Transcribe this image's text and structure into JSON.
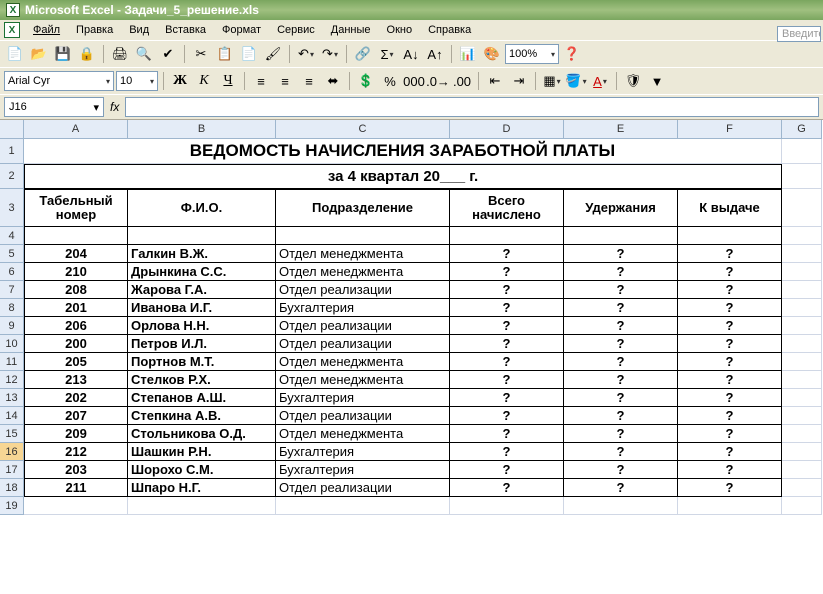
{
  "app": {
    "title": "Microsoft Excel - Задачи_5_решение.xls"
  },
  "search": {
    "placeholder": "Введите"
  },
  "menu": {
    "file": "Файл",
    "edit": "Правка",
    "view": "Вид",
    "insert": "Вставка",
    "format": "Формат",
    "service": "Сервис",
    "data": "Данные",
    "window": "Окно",
    "help": "Справка"
  },
  "toolbar": {
    "zoom": "100%"
  },
  "font": {
    "name": "Arial Cyr",
    "size": "10"
  },
  "namebox": {
    "value": "J16"
  },
  "columns": [
    "A",
    "B",
    "C",
    "D",
    "E",
    "F",
    "G"
  ],
  "rows": [
    "1",
    "2",
    "3",
    "4",
    "5",
    "6",
    "7",
    "8",
    "9",
    "10",
    "11",
    "12",
    "13",
    "14",
    "15",
    "16",
    "17",
    "18",
    "19"
  ],
  "sheet": {
    "title": "ВЕДОМОСТЬ НАЧИСЛЕНИЯ ЗАРАБОТНОЙ ПЛАТЫ",
    "subtitle": "за 4 квартал 20___ г.",
    "headers": {
      "a": "Табельный номер",
      "b": "Ф.И.О.",
      "c": "Подразделение",
      "d": "Всего начислено",
      "e": "Удержания",
      "f": "К выдаче"
    },
    "rows": [
      {
        "n": "204",
        "fio": "Галкин В.Ж.",
        "dep": "Отдел менеджмента",
        "d": "?",
        "e": "?",
        "f": "?"
      },
      {
        "n": "210",
        "fio": "Дрынкина С.С.",
        "dep": "Отдел менеджмента",
        "d": "?",
        "e": "?",
        "f": "?"
      },
      {
        "n": "208",
        "fio": "Жарова Г.А.",
        "dep": "Отдел реализации",
        "d": "?",
        "e": "?",
        "f": "?"
      },
      {
        "n": "201",
        "fio": "Иванова И.Г.",
        "dep": "Бухгалтерия",
        "d": "?",
        "e": "?",
        "f": "?"
      },
      {
        "n": "206",
        "fio": "Орлова Н.Н.",
        "dep": "Отдел реализации",
        "d": "?",
        "e": "?",
        "f": "?"
      },
      {
        "n": "200",
        "fio": "Петров И.Л.",
        "dep": "Отдел реализации",
        "d": "?",
        "e": "?",
        "f": "?"
      },
      {
        "n": "205",
        "fio": "Портнов М.Т.",
        "dep": "Отдел менеджмента",
        "d": "?",
        "e": "?",
        "f": "?"
      },
      {
        "n": "213",
        "fio": "Стелков Р.Х.",
        "dep": "Отдел менеджмента",
        "d": "?",
        "e": "?",
        "f": "?"
      },
      {
        "n": "202",
        "fio": "Степанов А.Ш.",
        "dep": "Бухгалтерия",
        "d": "?",
        "e": "?",
        "f": "?"
      },
      {
        "n": "207",
        "fio": "Степкина А.В.",
        "dep": "Отдел реализации",
        "d": "?",
        "e": "?",
        "f": "?"
      },
      {
        "n": "209",
        "fio": "Стольникова О.Д.",
        "dep": "Отдел менеджмента",
        "d": "?",
        "e": "?",
        "f": "?"
      },
      {
        "n": "212",
        "fio": "Шашкин Р.Н.",
        "dep": "Бухгалтерия",
        "d": "?",
        "e": "?",
        "f": "?"
      },
      {
        "n": "203",
        "fio": "Шорохо С.М.",
        "dep": "Бухгалтерия",
        "d": "?",
        "e": "?",
        "f": "?"
      },
      {
        "n": "211",
        "fio": "Шпаро Н.Г.",
        "dep": "Отдел реализации",
        "d": "?",
        "e": "?",
        "f": "?"
      }
    ]
  }
}
